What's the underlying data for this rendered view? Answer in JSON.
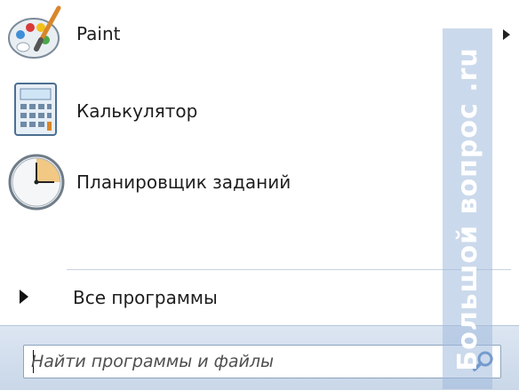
{
  "programs": [
    {
      "label": "Paint",
      "icon": "paint-palette-icon",
      "has_submenu": true
    },
    {
      "label": "Калькулятор",
      "icon": "calculator-icon",
      "has_submenu": false
    },
    {
      "label": "Планировщик заданий",
      "icon": "clock-icon",
      "has_submenu": false
    }
  ],
  "all_programs": {
    "label": "Все программы",
    "icon": "right-triangle-icon"
  },
  "search": {
    "value": "",
    "placeholder": "Найти программы и файлы",
    "icon": "magnifier-icon"
  },
  "watermark": {
    "text": "Большой вопрос .ru"
  },
  "colors": {
    "search_bar": "#d4e0ee",
    "separator": "#c9d3df",
    "accent": "#3f76b8"
  }
}
